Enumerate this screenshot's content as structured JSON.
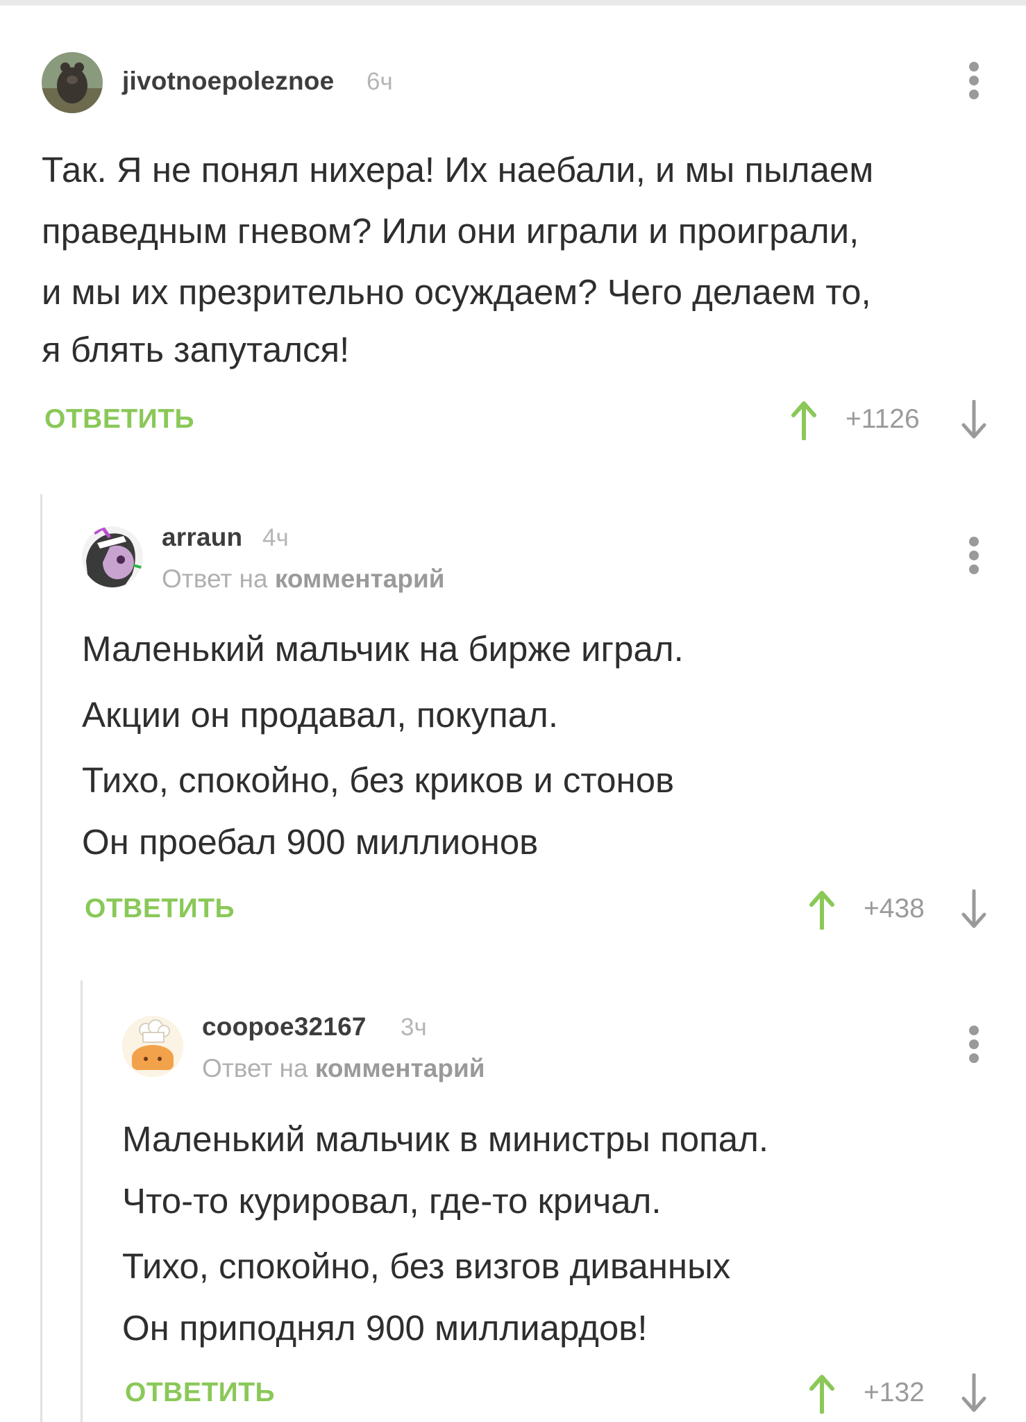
{
  "comments": [
    {
      "username": "jivotnoepoleznoe",
      "time": "6ч",
      "lines": [
        "Так. Я не понял нихера! Их наебали, и мы пылаем",
        "праведным гневом? Или они играли и проиграли,",
        "и мы их презрительно осуждаем? Чего делаем то,",
        "я блять запутался!"
      ],
      "reply_label": "ОТВЕТИТЬ",
      "rating": "+1126",
      "avatar_icon": "bear-avatar-icon"
    },
    {
      "username": "arraun",
      "time": "4ч",
      "reply_prefix": "Ответ на",
      "reply_target": "комментарий",
      "lines": [
        "Маленький мальчик на бирже играл.",
        "Акции он продавал, покупал.",
        "Тихо, спокойно, без криков и стонов",
        "Он проебал 900 миллионов"
      ],
      "reply_label": "ОТВЕТИТЬ",
      "rating": "+438",
      "avatar_icon": "pony-avatar-icon"
    },
    {
      "username": "coopoe32167",
      "time": "3ч",
      "reply_prefix": "Ответ на",
      "reply_target": "комментарий",
      "lines": [
        "Маленький мальчик в министры попал.",
        "Что-то курировал, где-то кричал.",
        "Тихо, спокойно, без визгов диванных",
        "Он приподнял 900 миллиардов!"
      ],
      "reply_label": "ОТВЕТИТЬ",
      "rating": "+132",
      "avatar_icon": "chef-avatar-icon"
    }
  ],
  "colors": {
    "accent_green": "#8ac858",
    "text": "#2e2e2e",
    "muted": "#b0b0b0",
    "thread_line": "#e1e1e1"
  }
}
